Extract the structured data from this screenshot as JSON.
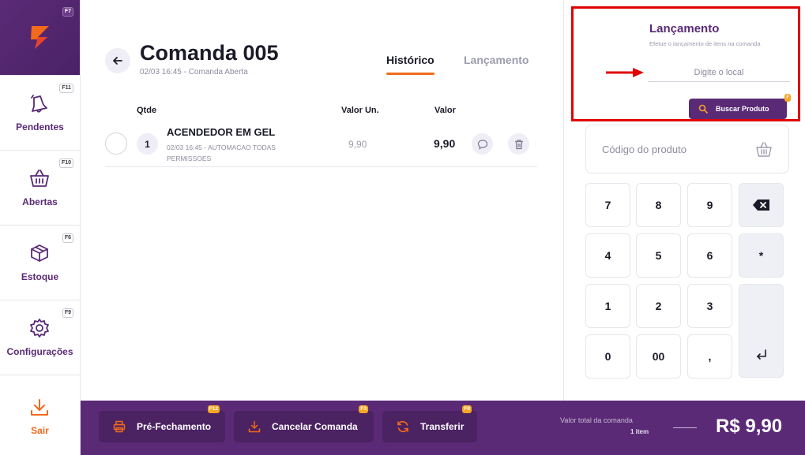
{
  "colors": {
    "brand_purple": "#5a2a76",
    "accent_orange": "#f26a1b",
    "highlight_red": "#e10000",
    "badge_yellow": "#f5a623"
  },
  "sidebar": {
    "logo_key": "F7",
    "items": [
      {
        "label": "Pendentes",
        "key": "F11",
        "icon": "bell-icon"
      },
      {
        "label": "Abertas",
        "key": "F10",
        "icon": "basket-icon"
      },
      {
        "label": "Estoque",
        "key": "F6",
        "icon": "box-icon"
      },
      {
        "label": "Configurações",
        "key": "F9",
        "icon": "gear-icon"
      },
      {
        "label": "Sair",
        "icon": "download-icon"
      }
    ]
  },
  "header": {
    "title": "Comanda 005",
    "subtitle": "02/03 16:45 - Comanda Aberta",
    "tabs": [
      {
        "label": "Histórico",
        "active": true
      },
      {
        "label": "Lançamento",
        "active": false
      }
    ]
  },
  "table": {
    "headers": {
      "qty": "Qtde",
      "unit": "Valor Un.",
      "value": "Valor"
    },
    "rows": [
      {
        "qty": "1",
        "name": "ACENDEDOR EM GEL",
        "desc": "02/03 16:45 - AUTOMACAO TODAS PERMISSOES",
        "unit": "9,90",
        "value": "9,90"
      }
    ]
  },
  "lancamento": {
    "title": "Lançamento",
    "subtitle": "Efetue o lançamento de itens na comanda",
    "local_placeholder": "Digite o local",
    "search_label": "Buscar Produto",
    "search_key": "F"
  },
  "code_input": {
    "placeholder": "Código do produto"
  },
  "keypad": {
    "keys": [
      "7",
      "8",
      "9",
      "4",
      "5",
      "6",
      "*",
      "1",
      "2",
      "3",
      "0",
      "00",
      ","
    ]
  },
  "footer": {
    "buttons": [
      {
        "label": "Pré-Fechamento",
        "key": "F12",
        "icon": "printer-icon"
      },
      {
        "label": "Cancelar Comanda",
        "key": "F3",
        "icon": "download-icon"
      },
      {
        "label": "Transferir",
        "key": "F8",
        "icon": "refresh-icon"
      }
    ],
    "total_label": "Valor total da comanda",
    "total_items": "1 item",
    "total_value": "R$ 9,90"
  }
}
